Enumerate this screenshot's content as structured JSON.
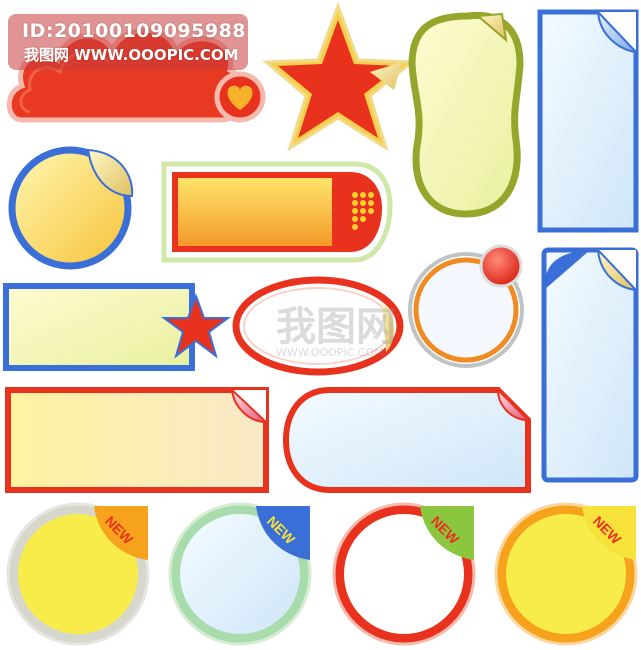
{
  "watermark": {
    "id_text": "ID:20100109095988",
    "site_text": "我图网  WWW.OOOPIC.COM",
    "center_logo": "我图网",
    "center_url": "WWW.OOOPIC.COM"
  },
  "badges": {
    "new_label": "NEW"
  },
  "colors": {
    "red": "#e8321e",
    "orange": "#f5a623",
    "yellow": "#f7e23a",
    "blue": "#3a6fd8",
    "green": "#8ccf8c",
    "olive": "#8a9a2a",
    "light_blue": "#dcefff",
    "pale_yellow": "#fbf0a8"
  },
  "icons": [
    "heart-icon",
    "star-icon",
    "peel-corner-icon",
    "dot-grid-icon",
    "red-ball-icon"
  ]
}
